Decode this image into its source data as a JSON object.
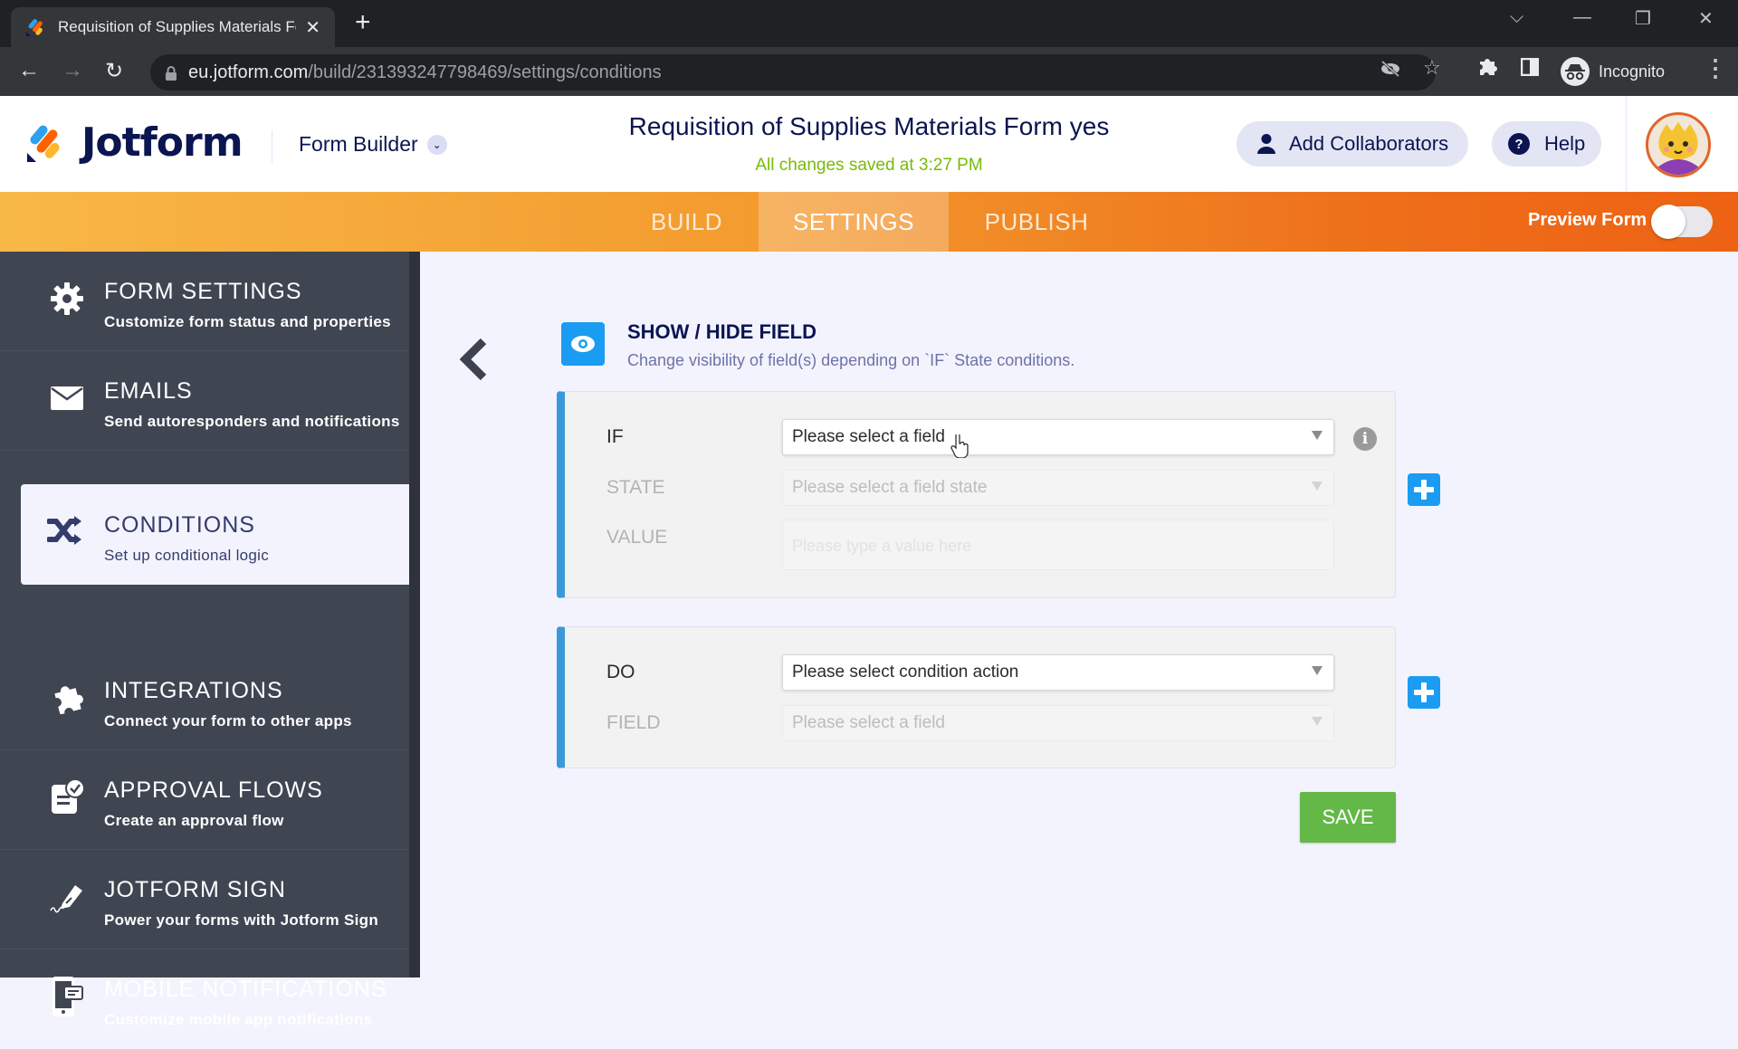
{
  "browser": {
    "tab_title": "Requisition of Supplies Materials Form yes",
    "url_host": "eu.jotform.com",
    "url_path": "/build/231393247798469/settings/conditions",
    "profile_label": "Incognito"
  },
  "header": {
    "logo_text": "Jotform",
    "product_menu": "Form Builder",
    "form_title": "Requisition of Supplies Materials Form yes",
    "save_status": "All changes saved at 3:27 PM",
    "add_collaborators": "Add Collaborators",
    "help": "Help"
  },
  "nav": {
    "tabs": [
      {
        "label": "BUILD",
        "active": false
      },
      {
        "label": "SETTINGS",
        "active": true
      },
      {
        "label": "PUBLISH",
        "active": false
      }
    ],
    "preview_label": "Preview Form",
    "preview_on": false
  },
  "sidebar": {
    "items": [
      {
        "title": "FORM SETTINGS",
        "desc": "Customize form status and properties",
        "icon": "gear-icon"
      },
      {
        "title": "EMAILS",
        "desc": "Send autoresponders and notifications",
        "icon": "envelope-icon"
      },
      {
        "title": "CONDITIONS",
        "desc": "Set up conditional logic",
        "icon": "shuffle-icon",
        "active": true
      },
      {
        "title": "INTEGRATIONS",
        "desc": "Connect your form to other apps",
        "icon": "puzzle-icon"
      },
      {
        "title": "APPROVAL FLOWS",
        "desc": "Create an approval flow",
        "icon": "approval-icon"
      },
      {
        "title": "JOTFORM SIGN",
        "desc": "Power your forms with Jotform Sign",
        "icon": "pen-icon"
      },
      {
        "title": "MOBILE NOTIFICATIONS",
        "desc": "Customize mobile app notifications",
        "icon": "mobile-icon"
      }
    ]
  },
  "condition": {
    "type_title": "SHOW / HIDE FIELD",
    "type_desc": "Change visibility of field(s) depending on `IF` State conditions.",
    "if_block": {
      "if_label": "IF",
      "if_value": "Please select a field",
      "state_label": "STATE",
      "state_placeholder": "Please select a field state",
      "value_label": "VALUE",
      "value_placeholder": "Please type a value here"
    },
    "do_block": {
      "do_label": "DO",
      "do_value": "Please select condition action",
      "field_label": "FIELD",
      "field_placeholder": "Please select a field"
    },
    "save_label": "SAVE"
  },
  "colors": {
    "brand_navy": "#0a1551",
    "accent_blue": "#1a9cf2",
    "save_green": "#64b847",
    "saved_text_green": "#78bb07",
    "sidebar_bg": "#404552",
    "nav_orange": "#f39a2e"
  }
}
